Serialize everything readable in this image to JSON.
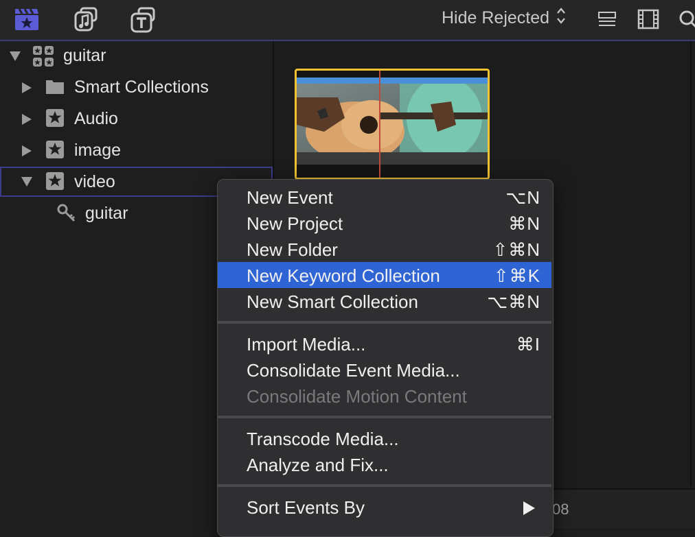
{
  "toolbar": {
    "icons": [
      "libraries-clapper-icon",
      "photos-audio-icon",
      "titles-generators-icon"
    ],
    "filter_label": "Hide Rejected",
    "right_icons": [
      "clip-appearance-icon",
      "filmstrip-icon",
      "search-icon"
    ]
  },
  "sidebar": {
    "items": [
      {
        "label": "guitar",
        "icon": "library-icon",
        "expanded": true
      },
      {
        "label": "Smart Collections",
        "icon": "folder-icon",
        "expanded": false
      },
      {
        "label": "Audio",
        "icon": "event-star-icon",
        "expanded": false
      },
      {
        "label": "image",
        "icon": "event-star-icon",
        "expanded": false
      },
      {
        "label": "video",
        "icon": "event-star-icon",
        "expanded": true,
        "selected": true
      },
      {
        "label": "guitar",
        "icon": "keyword-icon"
      }
    ]
  },
  "browser": {
    "bottom_text": "08"
  },
  "menu": {
    "items": [
      {
        "label": "New Event",
        "shortcut": "⌥N"
      },
      {
        "label": "New Project",
        "shortcut": "⌘N"
      },
      {
        "label": "New Folder",
        "shortcut": "⇧⌘N"
      },
      {
        "label": "New Keyword Collection",
        "shortcut": "⇧⌘K",
        "highlighted": true
      },
      {
        "label": "New Smart Collection",
        "shortcut": "⌥⌘N"
      },
      {
        "label": "Import Media...",
        "shortcut": "⌘I"
      },
      {
        "label": "Consolidate Event Media...",
        "shortcut": ""
      },
      {
        "label": "Consolidate Motion Content",
        "shortcut": "",
        "disabled": true
      },
      {
        "label": "Transcode Media...",
        "shortcut": ""
      },
      {
        "label": "Analyze and Fix...",
        "shortcut": ""
      },
      {
        "label": "Sort Events By",
        "shortcut": "",
        "submenu": true
      }
    ]
  },
  "colors": {
    "highlight": "#2f64d4",
    "clip_border": "#f1c232",
    "toolbar_accent": "#5b5bd6"
  }
}
